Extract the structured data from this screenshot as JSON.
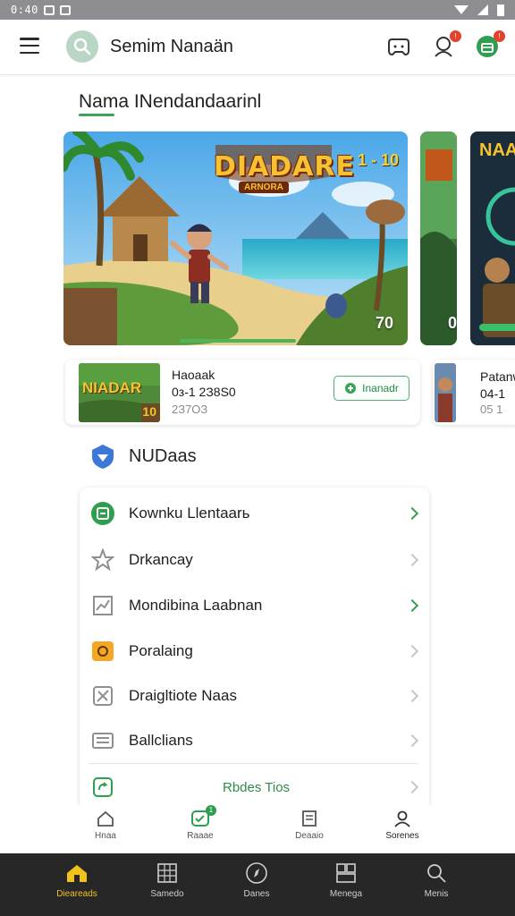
{
  "status_bar": {
    "time": "0:40"
  },
  "app_bar": {
    "title": "Semim Nanaän",
    "icons": [
      "menu-icon",
      "search-icon",
      "gamepad-icon",
      "notification-icon",
      "store-icon"
    ],
    "notification_badge": "!",
    "store_badge": "!"
  },
  "featured": {
    "title": "Nama INendandaarinl",
    "banners": [
      {
        "game_title": "DIADARE",
        "subtitle": "ARNORA",
        "corner_label": "1 - 10",
        "number": "70"
      },
      {
        "number": "0"
      },
      {
        "game_title": "NAA"
      }
    ]
  },
  "game_cards": [
    {
      "thumb_title": "NIADAR",
      "thumb_number": "10",
      "name": "Haoaak",
      "code": "0з-1 2З8S0",
      "sub": "2З7ОЗ",
      "button_label": "Inanadr"
    },
    {
      "name": "Patanw",
      "code": "04-1",
      "sub": "05 1"
    }
  ],
  "categories": {
    "title": "NUDaas",
    "items": [
      {
        "label": "Kownku Llentaarь",
        "icon": "calendar-icon",
        "icon_color": "#2f9e4f",
        "chevron": "green"
      },
      {
        "label": "Drkancay",
        "icon": "star-icon",
        "icon_color": "#9a9a9a",
        "chevron": "gray"
      },
      {
        "label": "Mondibina Laabnan",
        "icon": "chart-icon",
        "icon_color": "#9a9a9a",
        "chevron": "green"
      },
      {
        "label": "Poralaing",
        "icon": "gift-icon",
        "icon_color": "#f5a623",
        "chevron": "gray"
      },
      {
        "label": "Draigltiote Naas",
        "icon": "tools-icon",
        "icon_color": "#9a9a9a",
        "chevron": "gray"
      },
      {
        "label": "Ballclians",
        "icon": "keyboard-icon",
        "icon_color": "#9a9a9a",
        "chevron": "gray"
      }
    ],
    "footer_label": "Rbdes Tios"
  },
  "inner_tabs": [
    {
      "label": "Hnaa",
      "icon": "home-icon"
    },
    {
      "label": "Raaae",
      "icon": "chat-icon",
      "badge": "1"
    },
    {
      "label": "Deaaio",
      "icon": "document-icon"
    },
    {
      "label": "Sorenes",
      "icon": "profile-icon"
    }
  ],
  "bottom_nav": [
    {
      "label": "Dieareads",
      "icon": "home-icon",
      "active": true
    },
    {
      "label": "Samedo",
      "icon": "grid-icon",
      "active": false
    },
    {
      "label": "Danes",
      "icon": "compass-icon",
      "active": false
    },
    {
      "label": "Menega",
      "icon": "library-icon",
      "active": false
    },
    {
      "label": "Menis",
      "icon": "search-icon",
      "active": false
    }
  ],
  "colors": {
    "accent_green": "#3aa35a",
    "status_bar": "#8e8e92",
    "bottom_nav_bg": "#272727",
    "active_nav": "#f2c21c",
    "badge_red": "#e2432f"
  }
}
